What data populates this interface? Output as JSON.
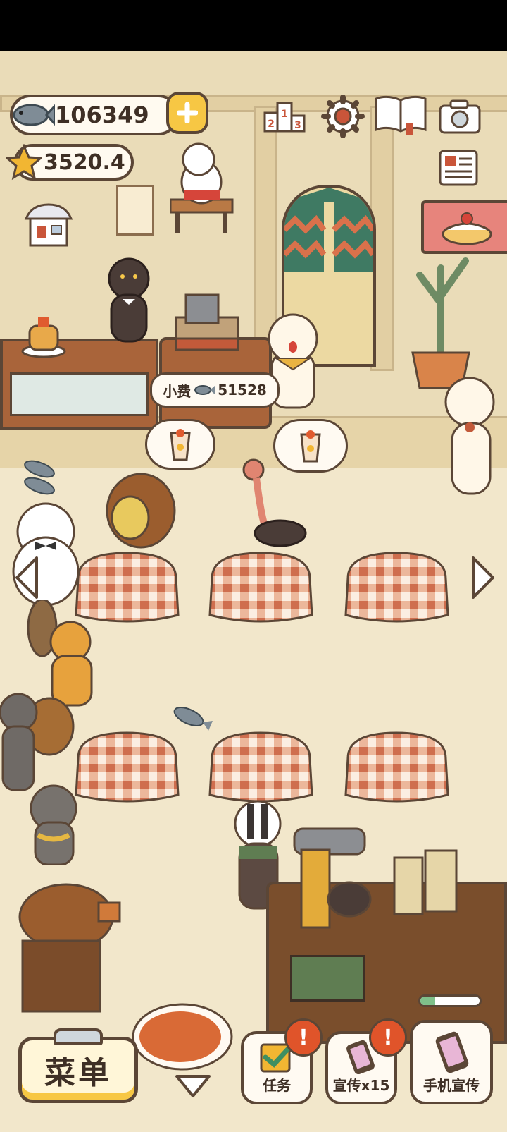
{
  "hud": {
    "fish_count": "106349",
    "star_count": "3520.4"
  },
  "tip": {
    "label": "小费",
    "amount": "51528"
  },
  "bottom_bar": {
    "menu_label": "菜单",
    "tasks_label": "任务",
    "promote_label": "宣传x15",
    "phone_promote_label": "手机宣传",
    "alert_mark": "!"
  },
  "icons": {
    "fish": "fish-icon",
    "star": "star-icon",
    "plus": "plus-icon",
    "ranking": "ranking-podium-icon",
    "settings": "gear-icon",
    "recipe_book": "book-icon",
    "camera": "camera-icon",
    "newspaper": "newspaper-icon",
    "shop": "shop-icon"
  },
  "colors": {
    "outline": "#5b4636",
    "accent_yellow": "#f7c744",
    "alert_red": "#e0542a",
    "tablecloth": "#d9825f",
    "wall": "#eadcb8",
    "floor": "#f2e7cb"
  },
  "progress": {
    "level": 0.25
  }
}
